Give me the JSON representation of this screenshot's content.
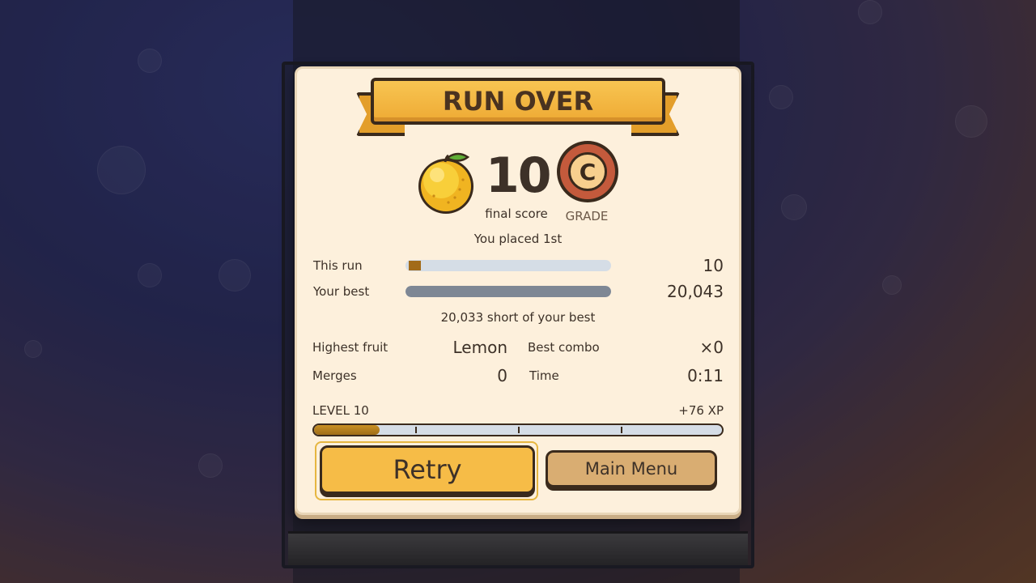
{
  "panel": {
    "title": "RUN OVER",
    "score": "10",
    "score_label": "final score",
    "grade": "C",
    "grade_label": "GRADE",
    "placement": "You placed 1st"
  },
  "comparison": {
    "this_run_label": "This run",
    "this_run_value": "10",
    "this_run_fraction": 0.0005,
    "best_label": "Your best",
    "best_value": "20,043",
    "best_fraction": 1.0,
    "gap_text": "20,033 short of your best"
  },
  "stats": {
    "highest_fruit_label": "Highest fruit",
    "highest_fruit_value": "Lemon",
    "best_combo_label": "Best combo",
    "best_combo_value": "×0",
    "merges_label": "Merges",
    "merges_value": "0",
    "time_label": "Time",
    "time_value": "0:11"
  },
  "progress": {
    "level_label": "LEVEL 10",
    "xp_gain": "+76 XP",
    "xp_fraction": 0.16
  },
  "buttons": {
    "retry_label": "Retry",
    "menu_label": "Main Menu"
  },
  "icons": {
    "fruit": "lemon-icon",
    "grade": "grade-badge-icon"
  },
  "colors": {
    "accent": "#f6bc47",
    "panel": "#fdf0dc",
    "ink": "#3d3128",
    "grade_ring": "#c45a3c"
  }
}
